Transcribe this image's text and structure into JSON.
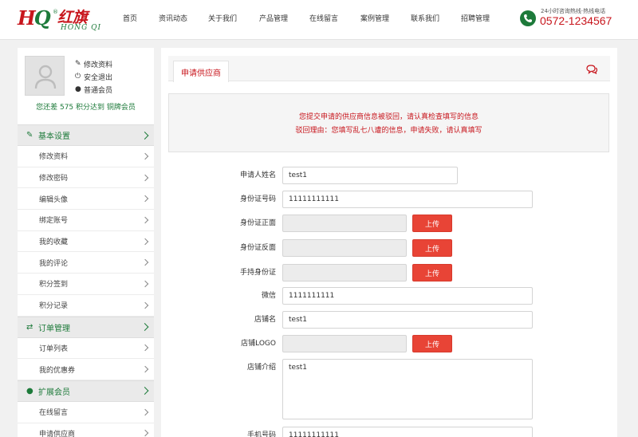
{
  "header": {
    "logo": {
      "mark": "HQ",
      "cn": "红旗",
      "en": "HONG QI",
      "reg": "®"
    },
    "nav": [
      "首页",
      "资讯动态",
      "关于我们",
      "产品管理",
      "在线留言",
      "案例管理",
      "联系我们",
      "招聘管理"
    ],
    "contact": {
      "label": "24小时咨询热线·热线电话",
      "phone": "0572-1234567"
    }
  },
  "sidebar": {
    "profile_links": [
      {
        "icon": "edit-icon",
        "label": "修改资料"
      },
      {
        "icon": "logout-icon",
        "label": "安全退出"
      },
      {
        "icon": "user-icon",
        "label": "普通会员"
      }
    ],
    "points_text": "您还差 575 积分达到 铜牌会员",
    "sections": [
      {
        "icon": "edit-icon",
        "title": "基本设置",
        "items": [
          "修改资料",
          "修改密码",
          "编辑头像",
          "绑定账号",
          "我的收藏",
          "我的评论",
          "积分签到",
          "积分记录"
        ]
      },
      {
        "icon": "exchange-icon",
        "title": "订单管理",
        "items": [
          "订单列表",
          "我的优惠券"
        ]
      },
      {
        "icon": "user-icon",
        "title": "扩展会员",
        "items": [
          "在线留言",
          "申请供应商"
        ]
      }
    ]
  },
  "main": {
    "tab": "申请供应商",
    "alert": {
      "line1": "您提交申请的供应商信息被驳回，请认真检查填写的信息",
      "line2": "驳回理由：您填写乱七八遭的信息，申请失败，请认真填写"
    },
    "upload_label": "上传",
    "form": {
      "name": {
        "label": "申请人姓名",
        "value": "test1"
      },
      "id_no": {
        "label": "身份证号码",
        "value": "11111111111"
      },
      "id_front": {
        "label": "身份证正面"
      },
      "id_back": {
        "label": "身份证反面"
      },
      "id_hold": {
        "label": "手持身份证"
      },
      "wechat": {
        "label": "微信",
        "value": "1111111111"
      },
      "shop_name": {
        "label": "店铺名",
        "value": "test1"
      },
      "shop_logo": {
        "label": "店铺LOGO"
      },
      "shop_intro": {
        "label": "店铺介绍",
        "value": "test1"
      },
      "mobile": {
        "label": "手机号码",
        "value": "11111111111"
      }
    }
  }
}
